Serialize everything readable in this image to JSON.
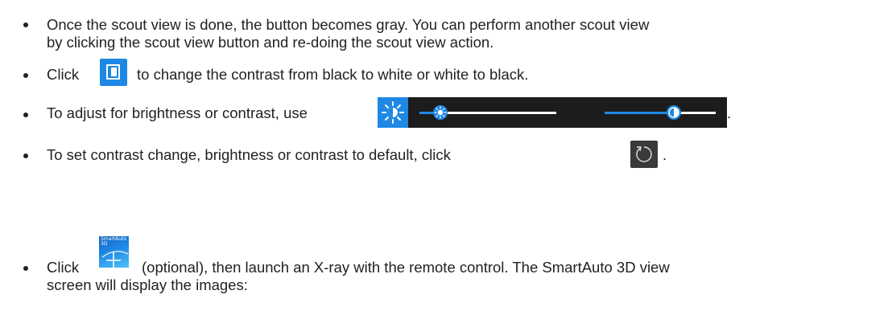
{
  "bullets": [
    {
      "line1": "Once the scout view is done, the button becomes gray. You can perform another scout view",
      "line2": "by clicking the scout view button and re-doing the scout view action."
    },
    {
      "before": "Click",
      "after": "to change the contrast from black to white or white to black."
    },
    {
      "before": "To adjust for brightness or contrast, use",
      "after": "."
    },
    {
      "before": "To set contrast change, brightness or contrast to default, click",
      "after": "."
    },
    {
      "before": "Click",
      "after": "(optional), then launch an X-ray with the remote control. The SmartAuto 3D view",
      "line2": "screen will display the images:"
    }
  ],
  "icons": {
    "smartauto_label_1": "SmartAuto",
    "smartauto_label_2": "3D",
    "contrast": "contrast-toggle-icon",
    "brightness": "sun-icon",
    "reset": "reset-icon"
  },
  "sliders": {
    "brightness_level": 0.15,
    "contrast_level": 0.62
  },
  "colors": {
    "accent": "#1e88e5",
    "bar_bg": "#1c1c1c",
    "reset_bg": "#3a3a3a"
  }
}
